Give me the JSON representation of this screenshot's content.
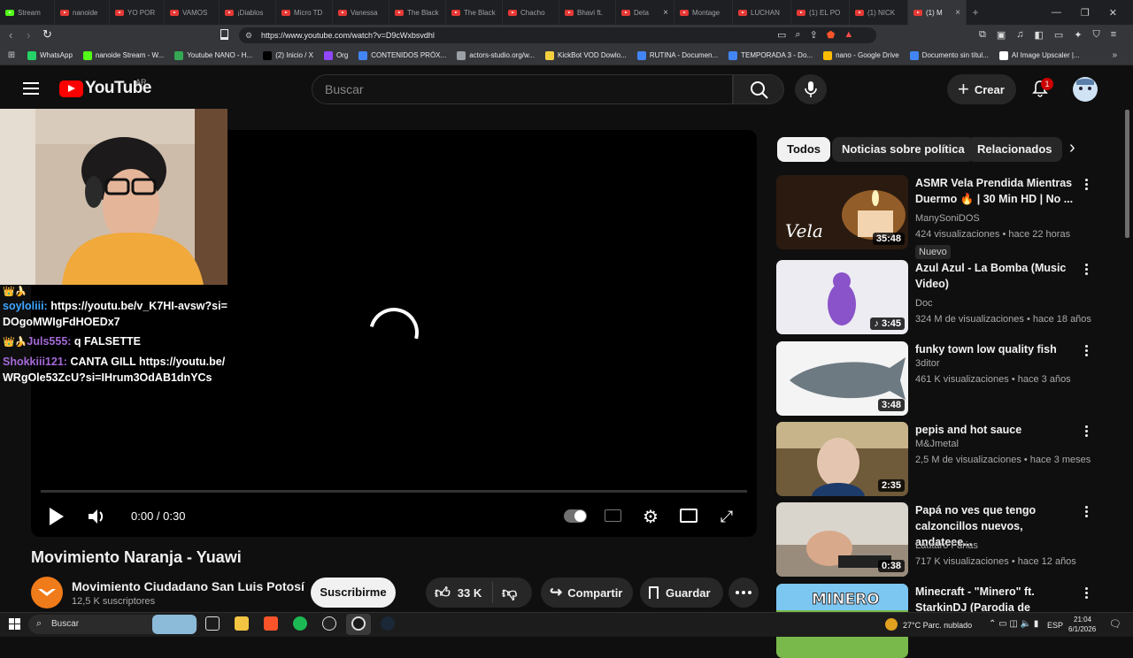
{
  "browser": {
    "tabs": [
      {
        "label": "Stream",
        "icon": "kick-icon"
      },
      {
        "label": "nanoide",
        "icon": "youtube-icon"
      },
      {
        "label": "YO POR",
        "icon": "youtube-icon"
      },
      {
        "label": "VAMOS",
        "icon": "youtube-icon"
      },
      {
        "label": "¡Diablos",
        "icon": "youtube-icon"
      },
      {
        "label": "Micro TD",
        "icon": "youtube-icon"
      },
      {
        "label": "Vanessa",
        "icon": "youtube-icon"
      },
      {
        "label": "The Black",
        "icon": "youtube-icon"
      },
      {
        "label": "The Black",
        "icon": "youtube-icon"
      },
      {
        "label": "Chacho",
        "icon": "youtube-icon"
      },
      {
        "label": "Bhavi ft.",
        "icon": "youtube-icon"
      },
      {
        "label": "Deta",
        "icon": "youtube-icon"
      },
      {
        "label": "Montage",
        "icon": "youtube-icon"
      },
      {
        "label": "LUCHAN",
        "icon": "youtube-icon"
      },
      {
        "label": "(1) EL PO",
        "icon": "youtube-icon"
      },
      {
        "label": "(1) NICK",
        "icon": "youtube-icon"
      },
      {
        "label": "(1) M",
        "icon": "youtube-icon"
      }
    ],
    "url": "https://www.youtube.com/watch?v=D9cWxbsvdhl",
    "bookmarks": [
      {
        "label": "WhatsApp",
        "color": "#25d366"
      },
      {
        "label": "nanoide Stream - W...",
        "color": "#53fc18"
      },
      {
        "label": "Youtube NANO - H...",
        "color": "#34a853"
      },
      {
        "label": "(2) Inicio / X",
        "color": "#000000"
      },
      {
        "label": "Org",
        "color": "#9146ff"
      },
      {
        "label": "CONTENIDOS PRÓX...",
        "color": "#4285f4"
      },
      {
        "label": "actors-studio.org/w...",
        "color": "#9aa0a6"
      },
      {
        "label": "KickBot VOD Dowlo...",
        "color": "#f4d03f"
      },
      {
        "label": "RUTINA - Documen...",
        "color": "#4285f4"
      },
      {
        "label": "TEMPORADA 3 - Do...",
        "color": "#4285f4"
      },
      {
        "label": "nano - Google Drive",
        "color": "#fbbc04"
      },
      {
        "label": "Documento sin títul...",
        "color": "#4285f4"
      },
      {
        "label": "AI Image Upscaler |...",
        "color": "#ffffff"
      }
    ]
  },
  "youtube": {
    "logo_text": "YouTube",
    "region": "AR",
    "search_placeholder": "Buscar",
    "create_label": "Crear",
    "notif_count": "1"
  },
  "player": {
    "time": "0:00 / 0:30",
    "progress": 0
  },
  "chat": [
    {
      "badge": "👑🍌",
      "user": "",
      "user_color": "#ffffff",
      "text": ""
    },
    {
      "badge": "",
      "user": "soyloliii:",
      "user_color": "#3ea6ff",
      "text": "https://youtu.be/v_K7HI-avsw?si=DOgoMWIgFdHOEDx7"
    },
    {
      "badge": "👑🍌",
      "user": "Juls555:",
      "user_color": "#a46ad8",
      "text": "q FALSETTE"
    },
    {
      "badge": "",
      "user": "Shokkiii121:",
      "user_color": "#a46ad8",
      "text": "CANTA GILL https://youtu.be/WRgOle53ZcU?si=IHrum3OdAB1dnYCs"
    }
  ],
  "video": {
    "title": "Movimiento Naranja - Yuawi",
    "channel": "Movimiento Ciudadano San Luis Potosí",
    "subscribers": "12,5 K suscriptores",
    "subscribe_label": "Suscribirme",
    "likes": "33 K",
    "share_label": "Compartir",
    "save_label": "Guardar"
  },
  "chips": [
    "Todos",
    "Noticias sobre política",
    "Relacionados"
  ],
  "recommendations": [
    {
      "title": "ASMR Vela Prendida Mientras Duermo 🔥 | 30 Min HD | No ...",
      "channel": "ManySoniDOS",
      "meta": "424 visualizaciones • hace 22 horas",
      "badge": "Nuevo",
      "duration": "35:48",
      "thumb_text": "Vela"
    },
    {
      "title": "Azul Azul - La Bomba (Music Video)",
      "channel": "Doc",
      "meta": "324 M de visualizaciones • hace 18 años",
      "badge": "",
      "duration": "♪ 3:45",
      "thumb_text": ""
    },
    {
      "title": "funky town low quality fish",
      "channel": "3ditor",
      "meta": "461 K visualizaciones • hace 3 años",
      "badge": "",
      "duration": "3:48",
      "thumb_text": ""
    },
    {
      "title": "pepis and hot sauce",
      "channel": "M&Jmetal",
      "meta": "2,5 M de visualizaciones • hace 3 meses",
      "badge": "",
      "duration": "2:35",
      "thumb_text": ""
    },
    {
      "title": "Papá no ves que tengo calzoncillos nuevos, andateee...",
      "channel": "Lautaro Farias",
      "meta": "717 K visualizaciones • hace 12 años",
      "badge": "",
      "duration": "0:38",
      "thumb_text": ""
    },
    {
      "title": "Minecraft - \"Minero\" ft. StarkinDJ (Parodia de \"Torero\"...",
      "channel": "",
      "meta": "",
      "badge": "",
      "duration": "",
      "thumb_text": "MINERO"
    }
  ],
  "taskbar": {
    "search_label": "Buscar",
    "weather": "27°C  Parc. nublado",
    "lang": "ESP",
    "time": "21:04",
    "date": "6/1/2026"
  }
}
